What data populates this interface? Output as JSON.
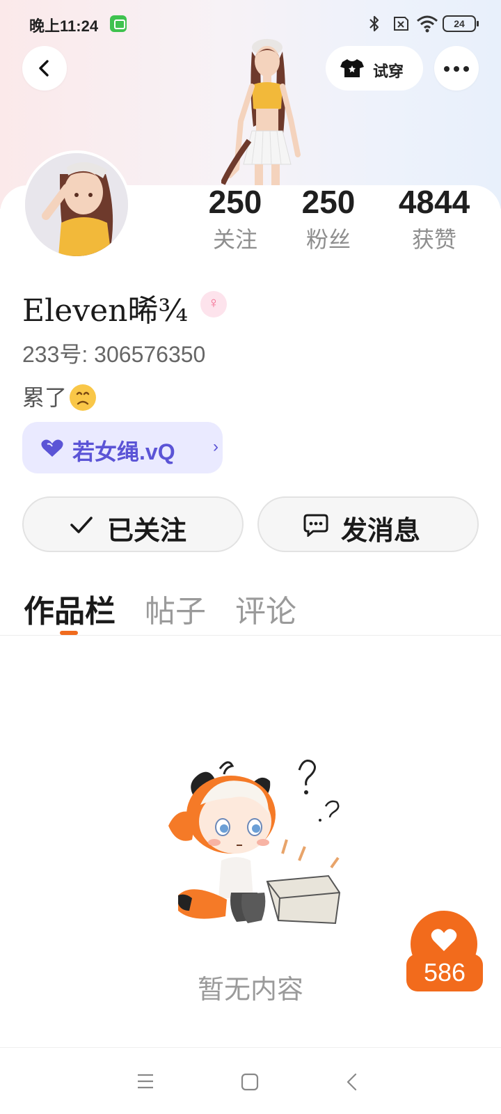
{
  "status_bar": {
    "time": "晚上11:24",
    "battery": "24"
  },
  "header": {
    "tryon_label": "试穿"
  },
  "profile": {
    "stats": [
      {
        "value": "250",
        "label": "关注"
      },
      {
        "value": "250",
        "label": "粉丝"
      },
      {
        "value": "4844",
        "label": "获赞"
      }
    ],
    "username": "Eleven晞¾",
    "gender_symbol": "♀",
    "uid": "233号: 306576350",
    "bio": "累了",
    "guild": "若女绳.vQ"
  },
  "actions": {
    "follow": "已关注",
    "message": "发消息"
  },
  "tabs": [
    "作品栏",
    "帖子",
    "评论"
  ],
  "empty_state": "暂无内容",
  "like_float": {
    "count": "586"
  },
  "colors": {
    "accent": "#f26b1c",
    "guild": "#5b54d6",
    "guild_bg": "#eaeaff"
  },
  "icons": [
    "back-icon",
    "tshirt-icon",
    "more-icon",
    "heart-icon",
    "check-icon",
    "chat-icon",
    "menu-icon",
    "home-icon",
    "nav-back-icon",
    "bluetooth-icon",
    "wifi-icon"
  ]
}
